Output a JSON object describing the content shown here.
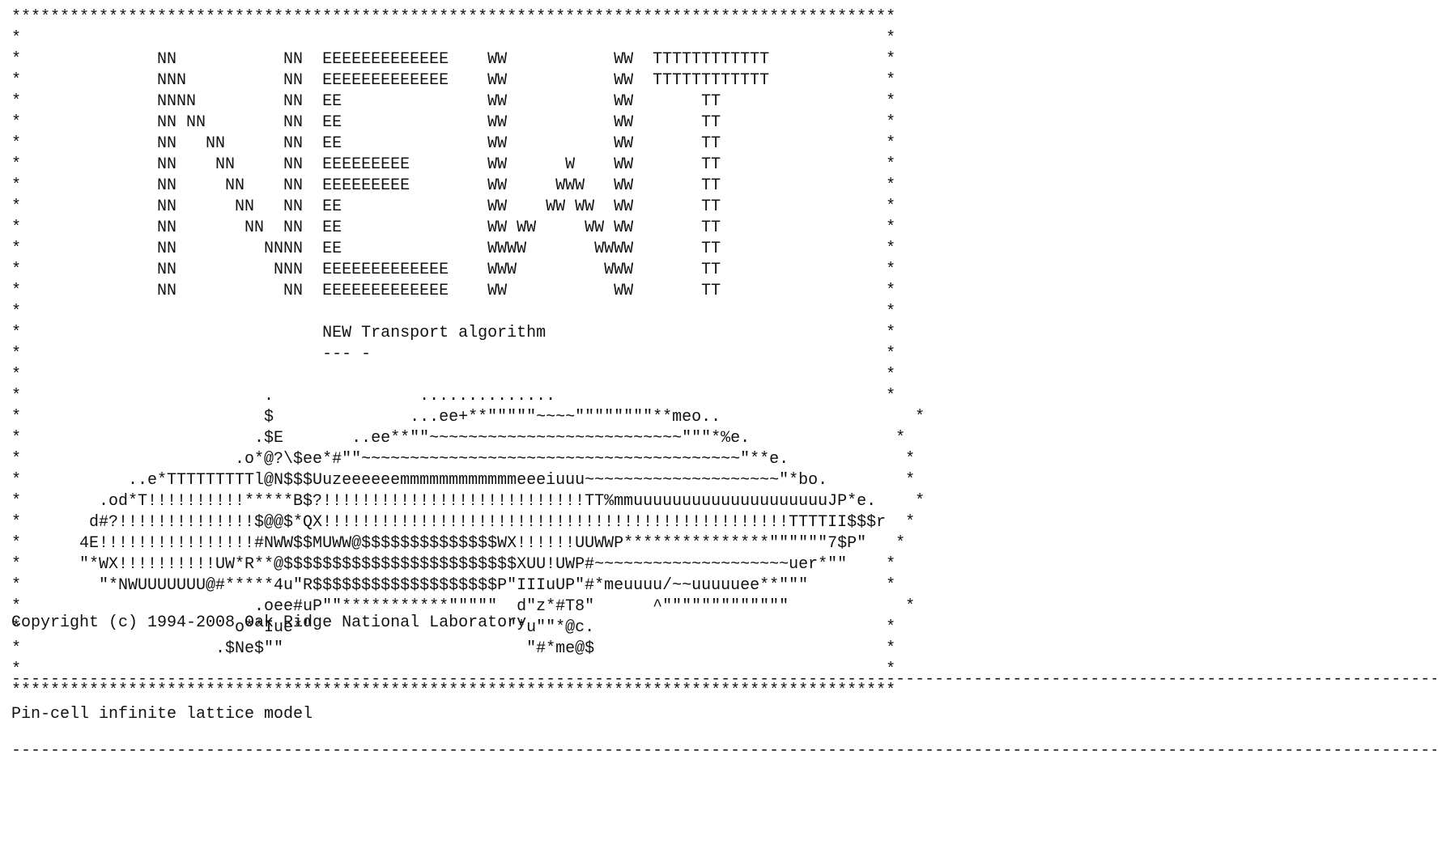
{
  "banner_lines": [
    "*******************************************************************************************",
    "*                                                                                         *",
    "*              NN           NN  EEEEEEEEEEEEE    WW           WW  TTTTTTTTTTTT            *",
    "*              NNN          NN  EEEEEEEEEEEEE    WW           WW  TTTTTTTTTTTT            *",
    "*              NNNN         NN  EE               WW           WW       TT                 *",
    "*              NN NN        NN  EE               WW           WW       TT                 *",
    "*              NN   NN      NN  EE               WW           WW       TT                 *",
    "*              NN    NN     NN  EEEEEEEEE        WW      W    WW       TT                 *",
    "*              NN     NN    NN  EEEEEEEEE        WW     WWW   WW       TT                 *",
    "*              NN      NN   NN  EE               WW    WW WW  WW       TT                 *",
    "*              NN       NN  NN  EE               WW WW     WW WW       TT                 *",
    "*              NN         NNNN  EE               WWWW       WWWW       TT                 *",
    "*              NN          NNN  EEEEEEEEEEEEE    WWW         WWW       TT                 *",
    "*              NN           NN  EEEEEEEEEEEEE    WW           WW       TT                 *",
    "*                                                                                         *",
    "*                               NEW Transport algorithm                                   *",
    "*                               --- -                                                     *",
    "*                                                                                         *",
    "*                         .               ..............                                  *",
    "*                         $              ...ee+**\"\"\"\"\"~~~~\"\"\"\"\"\"\"\"**meo..                    *",
    "*                        .$E       ..ee**\"\"~~~~~~~~~~~~~~~~~~~~~~~~~~\"\"\"*%e.               *",
    "*                      .o*@?\\$ee*#\"\"~~~~~~~~~~~~~~~~~~~~~~~~~~~~~~~~~~~~~~~\"**e.            *",
    "*           ..e*TTTTTTTTTl@N$$$Uuzeeeeeemmmmmmmmmmmmeeeiuuu~~~~~~~~~~~~~~~~~~~~\"*bo.        *",
    "*        .od*T!!!!!!!!!!*****B$?!!!!!!!!!!!!!!!!!!!!!!!!!!!TT%mmuuuuuuuuuuuuuuuuuuuuJP*e.    *",
    "*       d#?!!!!!!!!!!!!!!$@@$*QX!!!!!!!!!!!!!!!!!!!!!!!!!!!!!!!!!!!!!!!!!!!!!!!!TTTTII$$$r  *",
    "*      4E!!!!!!!!!!!!!!!!#NWW$$MUWW@$$$$$$$$$$$$$$WX!!!!!!UUWWP***************\"\"\"\"\"\"7$P\"   *",
    "*      \"*WX!!!!!!!!!!UW*R**@$$$$$$$$$$$$$$$$$$$$$$$$XUU!UWP#~~~~~~~~~~~~~~~~~~~~uer*\"\"    *",
    "*        \"*NWUUUUUUU@#*****4u\"R$$$$$$$$$$$$$$$$$$$P\"IIIuUP\"#*meuuuu/~~uuuuuee**\"\"\"        *",
    "*                        .oee#uP\"\"***********\"\"\"\"\"  d\"z*#T8\"      ^\"\"\"\"\"\"\"\"\"\"\"\"\"            *",
    "*                      o**Iue*\"                    \"*u\"\"*@c.                              *",
    "*                    .$Ne$\"\"                         \"#*me@$                              *",
    "*                                                                                         *",
    "*******************************************************************************************"
  ],
  "copyright": "Copyright (c) 1994-2008 Oak Ridge National Laboratory",
  "separator_top": "--------------------------------------------------------------------------------------------------------------------------------------------------------------------------------------",
  "problem_title": "Pin-cell infinite lattice model",
  "separator_bottom": "--------------------------------------------------------------------------------------------------------------------------------------------------------------------------------------"
}
